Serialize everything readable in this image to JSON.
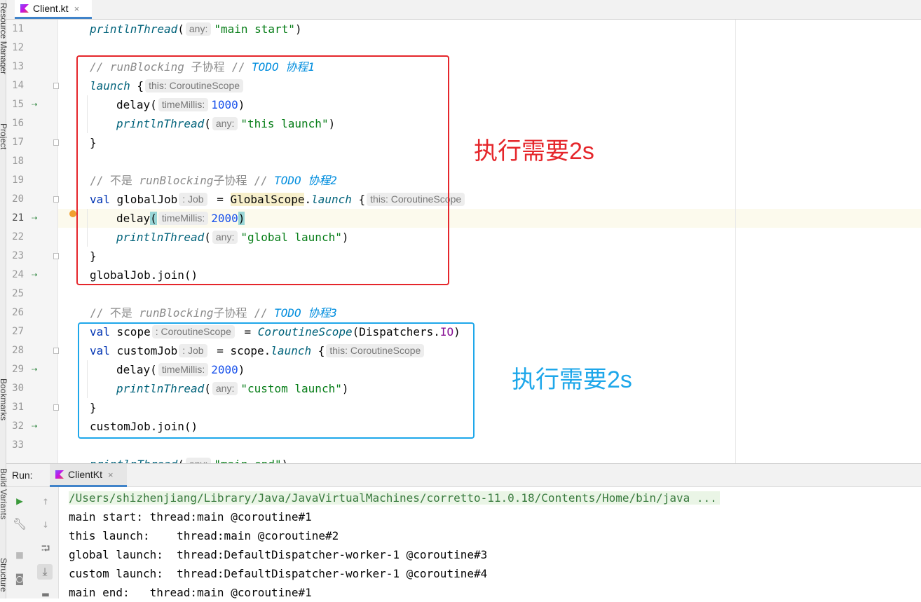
{
  "side_panels": [
    "Resource Manager",
    "Project",
    "Bookmarks",
    "Build Variants",
    "Structure"
  ],
  "editor_tab": {
    "label": "Client.kt",
    "close": "×"
  },
  "line_numbers": [
    "11",
    "12",
    "13",
    "14",
    "15",
    "16",
    "17",
    "18",
    "19",
    "20",
    "21",
    "22",
    "23",
    "24",
    "25",
    "26",
    "27",
    "28",
    "29",
    "30",
    "31",
    "32",
    "33"
  ],
  "code": {
    "l11": {
      "fn": "printlnThread",
      "p1": "(",
      "hint": "any:",
      "str": "\"main start\"",
      "p2": ")"
    },
    "l13": {
      "c1": "// ",
      "c2": "runBlocking",
      "c3": " 子协程 // ",
      "todo": "TODO",
      "cn": " 协程1"
    },
    "l14": {
      "fn": "launch",
      "brace": " {",
      "hint": "this: CoroutineScope"
    },
    "l15": {
      "fn": "delay",
      "p1": "(",
      "hint": "timeMillis:",
      "num": "1000",
      "p2": ")"
    },
    "l16": {
      "fn": "printlnThread",
      "p1": "(",
      "hint": "any:",
      "str": "\"this launch\"",
      "p2": ")"
    },
    "l17": {
      "brace": "}"
    },
    "l19": {
      "c1": "// 不是 ",
      "c2": "runBlocking",
      "c3": "子协程 // ",
      "todo": "TODO",
      "cn": " 协程2"
    },
    "l20": {
      "kw": "val",
      "name": " globalJob",
      "hint": ": Job",
      "eq": " = ",
      "scope": "GlobalScope",
      "dot": ".",
      "fn": "launch",
      "brace": " {",
      "hint2": "this: CoroutineScope"
    },
    "l21": {
      "fn": "delay",
      "p1": "(",
      "hint": "timeMillis:",
      "num": "2000",
      "p2": ")"
    },
    "l22": {
      "fn": "printlnThread",
      "p1": "(",
      "hint": "any:",
      "str": "\"global launch\"",
      "p2": ")"
    },
    "l23": {
      "brace": "}"
    },
    "l24": {
      "text": "globalJob.join()"
    },
    "l26": {
      "c1": "// 不是 ",
      "c2": "runBlocking",
      "c3": "子协程 // ",
      "todo": "TODO",
      "cn": " 协程3"
    },
    "l27": {
      "kw": "val",
      "name": " scope",
      "hint": ": CoroutineScope",
      "eq": " = ",
      "fn": "CoroutineScope",
      "p1": "(Dispatchers.",
      "io": "IO",
      "p2": ")"
    },
    "l28": {
      "kw": "val",
      "name": " customJob",
      "hint": ": Job",
      "eq": " = scope.",
      "fn": "launch",
      "brace": " {",
      "hint2": "this: CoroutineScope"
    },
    "l29": {
      "fn": "delay",
      "p1": "(",
      "hint": "timeMillis:",
      "num": "2000",
      "p2": ")"
    },
    "l30": {
      "fn": "printlnThread",
      "p1": "(",
      "hint": "any:",
      "str": "\"custom launch\"",
      "p2": ")"
    },
    "l31": {
      "brace": "}"
    },
    "l32": {
      "text": "customJob.join()"
    },
    "l34": {
      "fn": "printlnThread",
      "p1": "(",
      "hint": "any:",
      "str": "\"main end\"",
      "p2": ")"
    }
  },
  "annotations": {
    "red": {
      "text": "执行需要2s",
      "color": "#e5262b"
    },
    "blue": {
      "text": "执行需要2s",
      "color": "#1ea7ea"
    }
  },
  "run_panel": {
    "label": "Run:",
    "tab": "ClientKt",
    "close": "×",
    "console": [
      "/Users/shizhenjiang/Library/Java/JavaVirtualMachines/corretto-11.0.18/Contents/Home/bin/java ...",
      "main start: thread:main @coroutine#1",
      "this launch:    thread:main @coroutine#2",
      "global launch:  thread:DefaultDispatcher-worker-1 @coroutine#3",
      "custom launch:  thread:DefaultDispatcher-worker-1 @coroutine#4",
      "main end:   thread:main @coroutine#1"
    ]
  },
  "colors": {
    "accent": "#4083c9",
    "keyword": "#0033b3",
    "string": "#067d17",
    "number": "#1750eb",
    "todo": "#008dde"
  }
}
